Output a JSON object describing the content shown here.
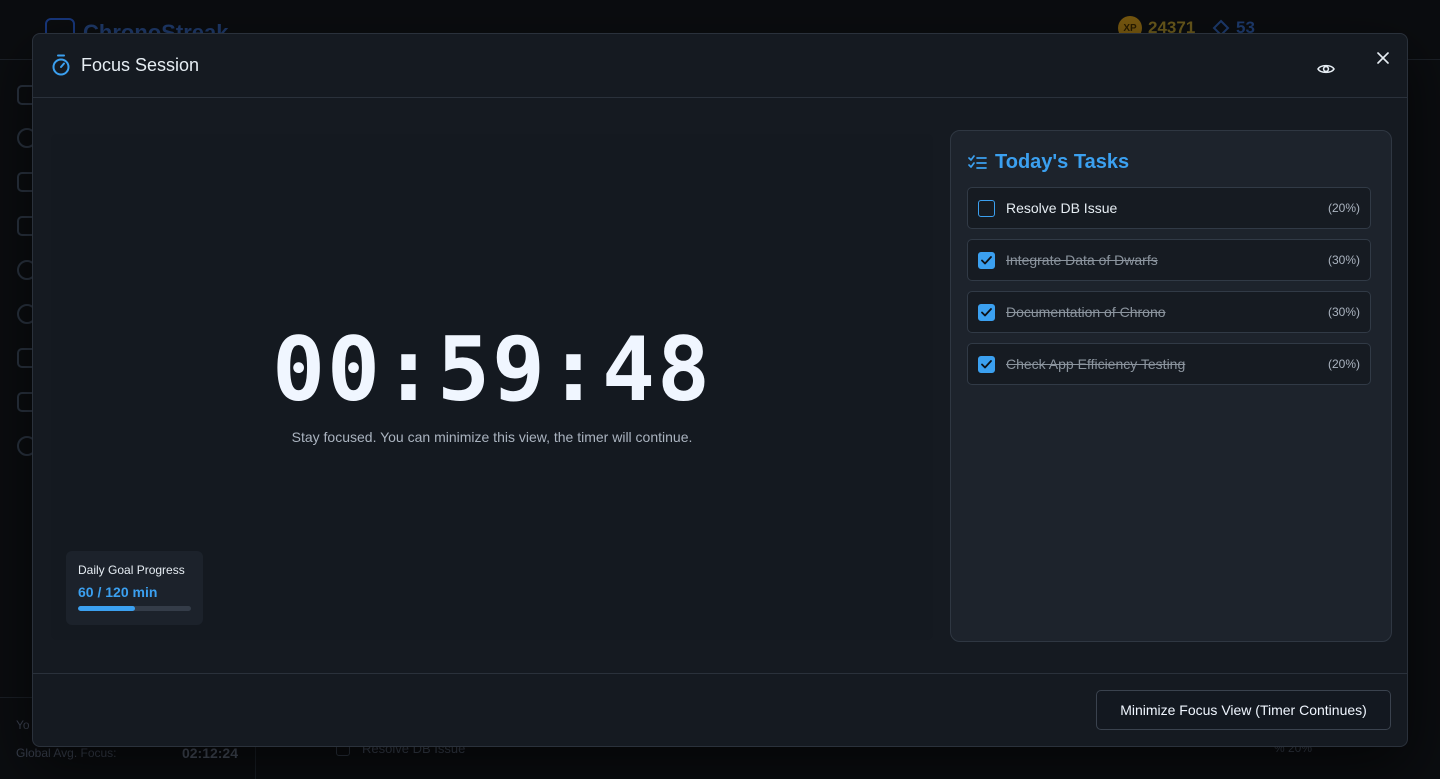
{
  "background": {
    "brand_name": "ChronoStreak",
    "xp_label": "XP",
    "xp_value": "24371",
    "gems_value": "53",
    "bottom_row1_label": "Yo",
    "bottom_row2_label": "Global Avg. Focus:",
    "bottom_row2_value": "02:12:24",
    "task_name": "Resolve DB Issue",
    "task_pct": "% 20%"
  },
  "modal": {
    "title": "Focus Session",
    "timer": "00:59:48",
    "subtitle": "Stay focused. You can minimize this view, the timer will continue.",
    "goal": {
      "label": "Daily Goal Progress",
      "value": "60 / 120 min",
      "progress": 0.5
    },
    "tasks": {
      "title": "Today's Tasks",
      "items": [
        {
          "name": "Resolve DB Issue",
          "pct": "(20%)",
          "done": false
        },
        {
          "name": "Integrate Data of Dwarfs",
          "pct": "(30%)",
          "done": true
        },
        {
          "name": "Documentation of Chrono",
          "pct": "(30%)",
          "done": true
        },
        {
          "name": "Check App Efficiency Testing",
          "pct": "(20%)",
          "done": true
        }
      ]
    },
    "footer_button": "Minimize Focus View (Timer Continues)"
  },
  "colors": {
    "accent": "#3ba0f0",
    "modal_bg": "#151a21",
    "panel_bg": "#1d232c"
  }
}
